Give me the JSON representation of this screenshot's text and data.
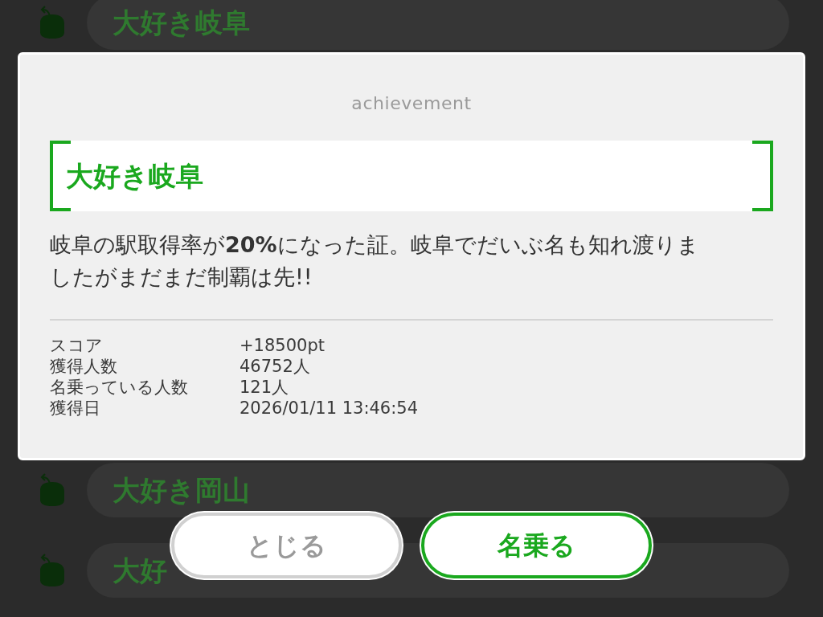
{
  "background_list": {
    "items": [
      {
        "title": "大好き岐阜"
      },
      {
        "title": "大好き岡山"
      },
      {
        "title": "大好"
      }
    ]
  },
  "dialog": {
    "heading": "achievement",
    "achievement_name": "大好き岐阜",
    "description": "岐阜の駅取得率が**20%**になった証。岐阜でだいぶ名も知れ渡りましたがまだまだ制覇は先!!",
    "stats": [
      {
        "label": "スコア",
        "value": "+18500pt"
      },
      {
        "label": "獲得人数",
        "value": "46752人"
      },
      {
        "label": "名乗っている人数",
        "value": "121人"
      },
      {
        "label": "獲得日",
        "value": "2026/01/11 13:46:54"
      }
    ],
    "buttons": [
      {
        "label": "とじる",
        "kind": "secondary"
      },
      {
        "label": "名乗る",
        "kind": "primary"
      }
    ]
  }
}
